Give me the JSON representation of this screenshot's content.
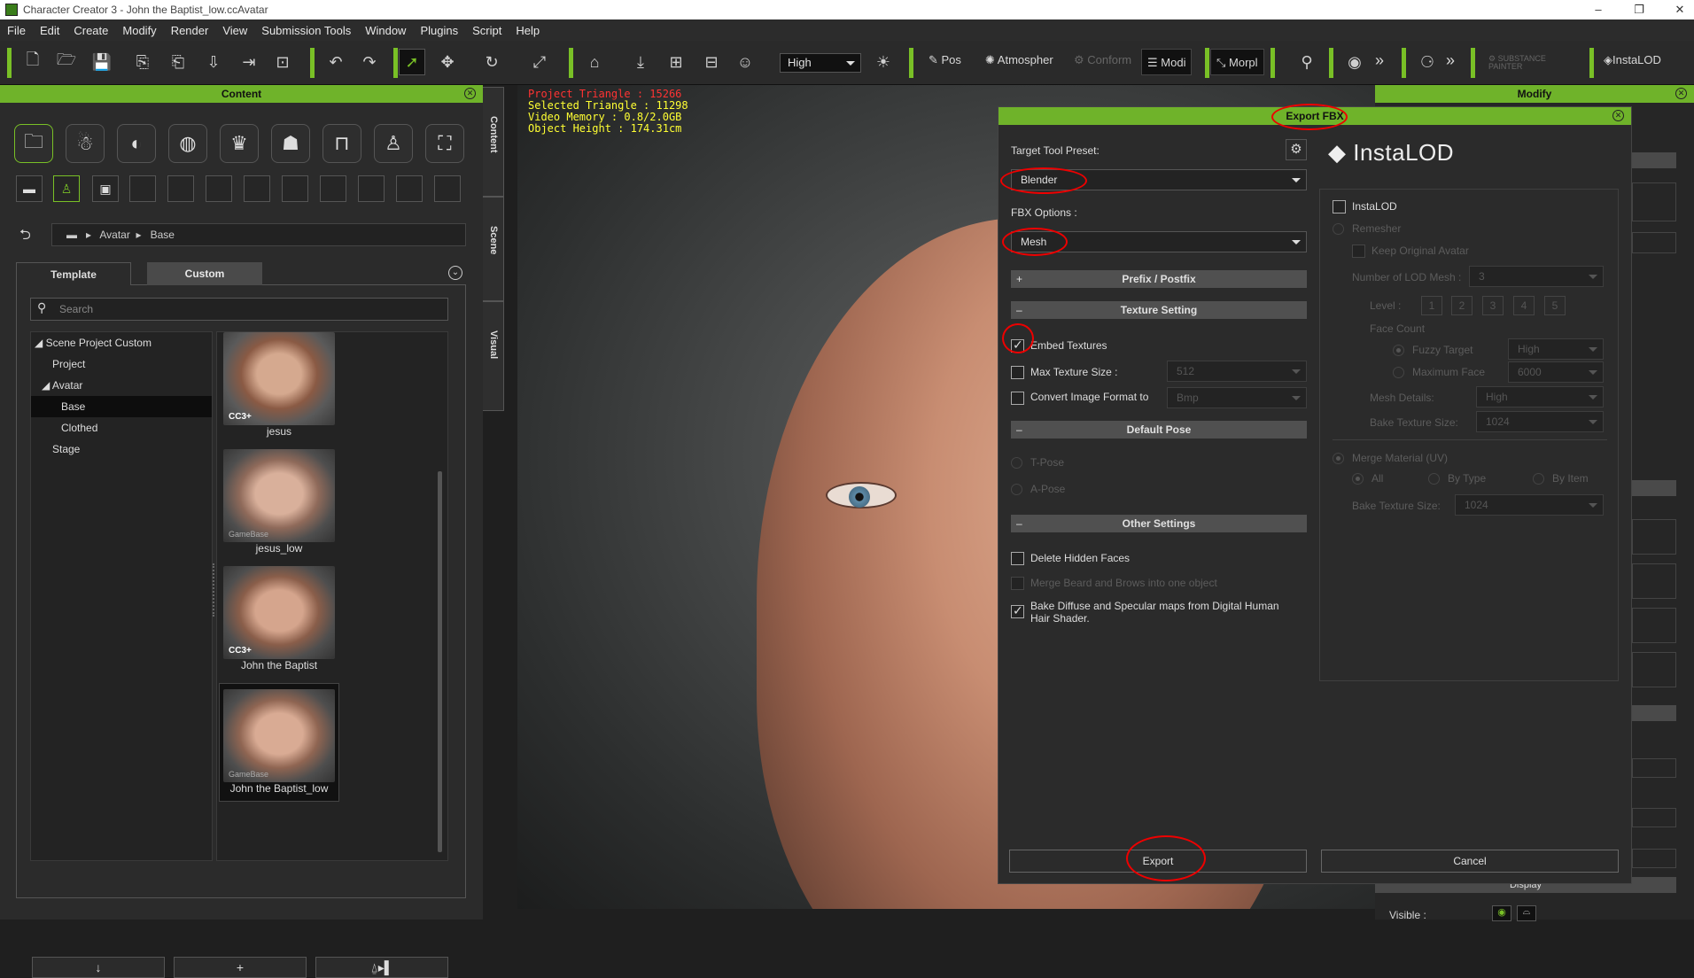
{
  "window": {
    "title": "Character Creator 3 - John the Baptist_low.ccAvatar",
    "controls": [
      "–",
      "❐",
      "✕"
    ]
  },
  "menu": [
    "File",
    "Edit",
    "Create",
    "Modify",
    "Render",
    "View",
    "Submission Tools",
    "Window",
    "Plugins",
    "Script",
    "Help"
  ],
  "toolbar": {
    "quality": "High",
    "pose": "Pos",
    "atmosphere": "Atmospher",
    "conform": "Conform",
    "modify": "Modi",
    "morph": "Morpl",
    "more": "»",
    "substance": "SUBSTANCE PAINTER",
    "instalod": "InstaLOD"
  },
  "content": {
    "title": "Content",
    "breadcrumb": {
      "back": "⮌",
      "folder": "▬",
      "items": [
        "Avatar",
        "Base"
      ],
      "sep": "▸"
    },
    "tabs": {
      "template": "Template",
      "custom": "Custom"
    },
    "search_placeholder": "Search",
    "tree": [
      {
        "label": "◢ Scene Project Custom",
        "indent": 0
      },
      {
        "label": "Project",
        "indent": 1
      },
      {
        "label": "◢ Avatar",
        "indent": 1
      },
      {
        "label": "Base",
        "indent": 2,
        "selected": true
      },
      {
        "label": "Clothed",
        "indent": 2
      },
      {
        "label": "Stage",
        "indent": 1
      }
    ],
    "thumbs": [
      {
        "label": "jesus",
        "badge": "CC3+"
      },
      {
        "label": "jesus_low",
        "badge": "GameBase"
      },
      {
        "label": "John the Baptist",
        "badge": "CC3+"
      },
      {
        "label": "John the Baptist_low",
        "badge": "GameBase",
        "selected": true
      }
    ],
    "bottom_buttons": [
      "↓",
      "+",
      "⍙▸▌"
    ]
  },
  "side_tabs": [
    "Content",
    "Scene",
    "Visual"
  ],
  "viewport": {
    "stats": [
      {
        "text": "Project Triangle : 15266",
        "color": "#ff3333"
      },
      {
        "text": "Selected Triangle : 11298",
        "color": "#ffff33"
      },
      {
        "text": "Video Memory : 0.8/2.0GB",
        "color": "#ffff33"
      },
      {
        "text": "Object Height : 174.31cm",
        "color": "#ffff33"
      }
    ]
  },
  "export_fbx": {
    "title": "Export FBX",
    "target_preset_label": "Target Tool Preset:",
    "target_preset": "Blender",
    "fbx_options_label": "FBX Options :",
    "fbx_options": "Mesh",
    "prefix_section": "Prefix / Postfix",
    "texture_section": "Texture Setting",
    "embed_textures": "Embed Textures",
    "max_texture_size": "Max Texture Size :",
    "max_texture_value": "512",
    "convert_format": "Convert Image Format to",
    "convert_value": "Bmp",
    "default_pose_section": "Default Pose",
    "tpose": "T-Pose",
    "apose": "A-Pose",
    "other_section": "Other Settings",
    "delete_hidden": "Delete Hidden Faces",
    "merge_beard": "Merge Beard and Brows into one object",
    "bake_diffuse_1": "Bake Diffuse and Specular maps from Digital Human",
    "bake_diffuse_2": "Hair Shader.",
    "export_button": "Export",
    "cancel_button": "Cancel",
    "instalod": {
      "logo": "InstaLOD",
      "checkbox": "InstaLOD",
      "remesher": "Remesher",
      "keep_original": "Keep Original Avatar",
      "num_lod_label": "Number of LOD Mesh :",
      "num_lod_value": "3",
      "level_label": "Level :",
      "levels": [
        "1",
        "2",
        "3",
        "4",
        "5"
      ],
      "face_count": "Face Count",
      "fuzzy_target": "Fuzzy Target",
      "fuzzy_value": "High",
      "maximum_face": "Maximum Face",
      "maximum_value": "6000",
      "mesh_details_label": "Mesh Details:",
      "mesh_details_value": "High",
      "bake_texture_label": "Bake Texture Size:",
      "bake_texture_value": "1024",
      "merge_material": "Merge Material (UV)",
      "merge_all": "All",
      "merge_bytype": "By Type",
      "merge_byitem": "By Item",
      "bake_texture2_label": "Bake Texture Size:",
      "bake_texture2_value": "1024"
    }
  },
  "modify": {
    "title": "Modify",
    "display": "Display",
    "visible": "Visible :"
  },
  "colors": {
    "accent": "#79c026",
    "annotation": "#e00000"
  }
}
